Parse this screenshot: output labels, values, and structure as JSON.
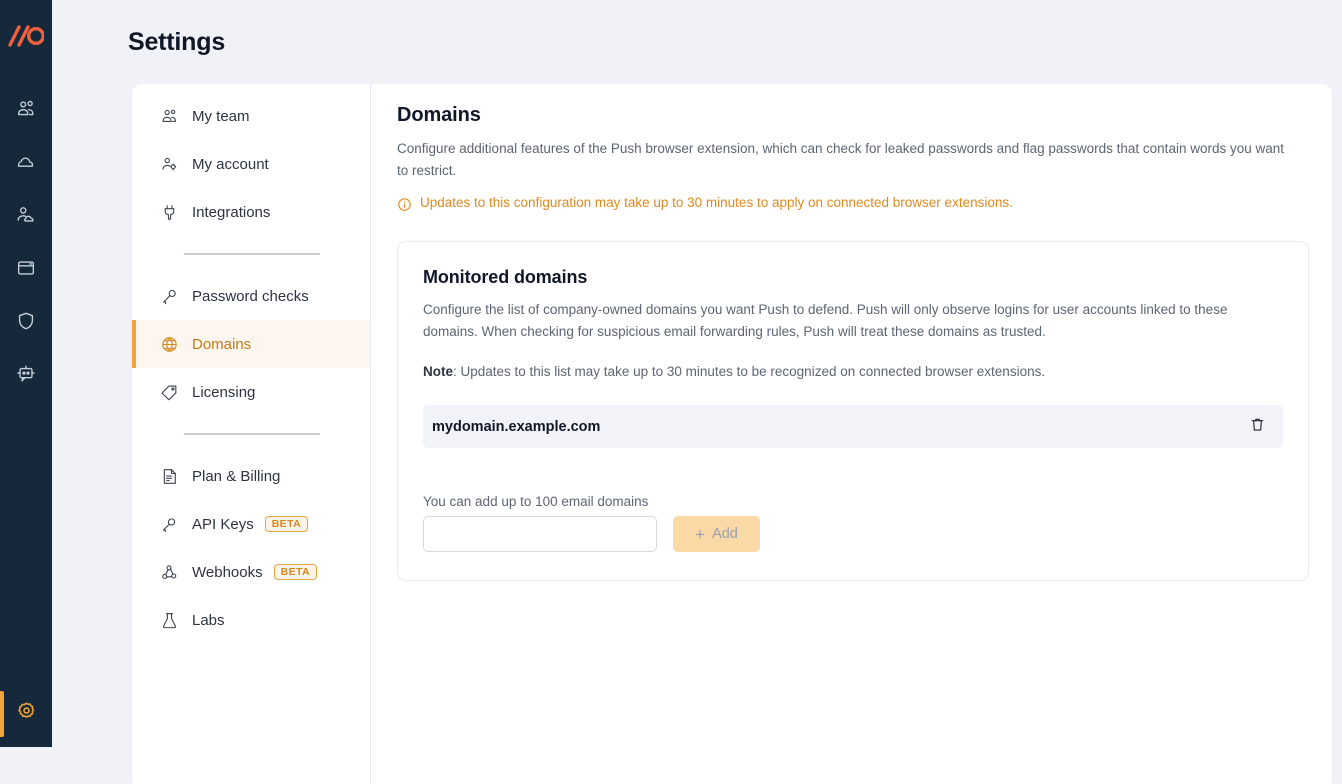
{
  "app_rail": {
    "logo_text": "//O",
    "logo_color": "#f2613f",
    "items": [
      {
        "icon": "people-group-icon",
        "name": "team"
      },
      {
        "icon": "cloud-icon",
        "name": "cloud"
      },
      {
        "icon": "user-cloud-icon",
        "name": "identity"
      },
      {
        "icon": "browser-window-icon",
        "name": "apps"
      },
      {
        "icon": "shield-icon",
        "name": "security"
      },
      {
        "icon": "chat-bot-icon",
        "name": "chat"
      }
    ],
    "settings": {
      "icon": "gear-icon",
      "name": "settings",
      "active": true,
      "active_color": "#f2a33c"
    }
  },
  "header": {
    "title": "Settings"
  },
  "settings_nav": {
    "groups": [
      {
        "items": [
          {
            "label": "My team",
            "icon": "people-group-icon",
            "active": false
          },
          {
            "label": "My account",
            "icon": "user-gear-icon",
            "active": false
          },
          {
            "label": "Integrations",
            "icon": "plug-icon",
            "active": false
          }
        ]
      },
      {
        "items": [
          {
            "label": "Password checks",
            "icon": "key-icon",
            "active": false
          },
          {
            "label": "Domains",
            "icon": "globe-icon",
            "active": true
          },
          {
            "label": "Licensing",
            "icon": "tag-icon",
            "active": false
          }
        ]
      },
      {
        "items": [
          {
            "label": "Plan & Billing",
            "icon": "invoice-icon",
            "active": false,
            "badge": ""
          },
          {
            "label": "API Keys",
            "icon": "key-icon",
            "active": false,
            "badge": "BETA"
          },
          {
            "label": "Webhooks",
            "icon": "webhook-icon",
            "active": false,
            "badge": "BETA"
          },
          {
            "label": "Labs",
            "icon": "flask-icon",
            "active": false,
            "badge": ""
          }
        ]
      }
    ]
  },
  "content": {
    "title": "Domains",
    "description": "Configure additional features of the Push browser extension, which can check for leaked passwords and flag passwords that contain words you want to restrict.",
    "notice": "Updates to this configuration may take up to 30 minutes to apply on connected browser extensions.",
    "notice_icon": "info-circle-icon",
    "notice_color": "#e08a1e"
  },
  "monitored_card": {
    "title": "Monitored domains",
    "description": "Configure the list of company-owned domains you want Push to defend. Push will only observe logins for user accounts linked to these domains. When checking for suspicious email forwarding rules, Push will treat these domains as trusted.",
    "note_label": "Note",
    "note_text": ": Updates to this list may take up to 30 minutes to be recognized on connected browser extensions.",
    "domains": [
      {
        "name": "mydomain.example.com",
        "delete_icon": "trash-icon"
      }
    ],
    "add_label": "You can add up to 100 email domains",
    "input_value": "",
    "input_placeholder": "",
    "add_button_label": "Add",
    "add_button_icon": "plus-icon"
  }
}
